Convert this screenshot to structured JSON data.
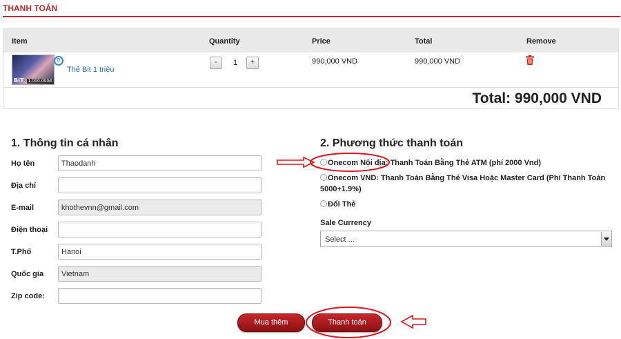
{
  "header": {
    "title": "THANH TOÁN"
  },
  "cart": {
    "columns": {
      "item": "Item",
      "quantity": "Quantity",
      "price": "Price",
      "total": "Total",
      "remove": "Remove"
    },
    "items": [
      {
        "thumb_label": "BIT",
        "thumb_amount": "1.000.000đ",
        "name": "Thẻ Bit 1 triệu",
        "minus": "-",
        "qty": "1",
        "plus": "+",
        "price": "990,000 VND",
        "total": "990,000 VND",
        "remove_icon": "trash-icon"
      }
    ],
    "grand_total": "Total: 990,000 VND"
  },
  "personal": {
    "title": "1. Thông tin cá nhân",
    "fields": [
      {
        "label": "Họ tên",
        "value": "Thaodanh"
      },
      {
        "label": "Địa chỉ",
        "value": ""
      },
      {
        "label": "E-mail",
        "value": "khothevnn@gmail.com"
      },
      {
        "label": "Điện thoại",
        "value": ""
      },
      {
        "label": "T.Phố",
        "value": "Hanoi"
      },
      {
        "label": "Quốc gia",
        "value": "Vietnam"
      },
      {
        "label": "Zip code:",
        "value": ""
      }
    ]
  },
  "payment": {
    "title": "2. Phương thức thanh toán",
    "options": [
      "Onecom Nội địa: Thanh Toán Bằng Thẻ ATM (phí 2000 Vnd)",
      "Onecom VND: Thanh Toán Bằng Thẻ Visa Hoặc Master Card (Phí Thanh Toán 5000+1.9%)",
      "Đổi Thẻ"
    ],
    "sale_currency_label": "Sale Currency",
    "sale_currency_value": "Select ..."
  },
  "actions": {
    "continue_label": "Mua thêm",
    "checkout_label": "Thanh toán"
  },
  "colors": {
    "accent": "#c0262d",
    "annotation": "#e0141c"
  }
}
